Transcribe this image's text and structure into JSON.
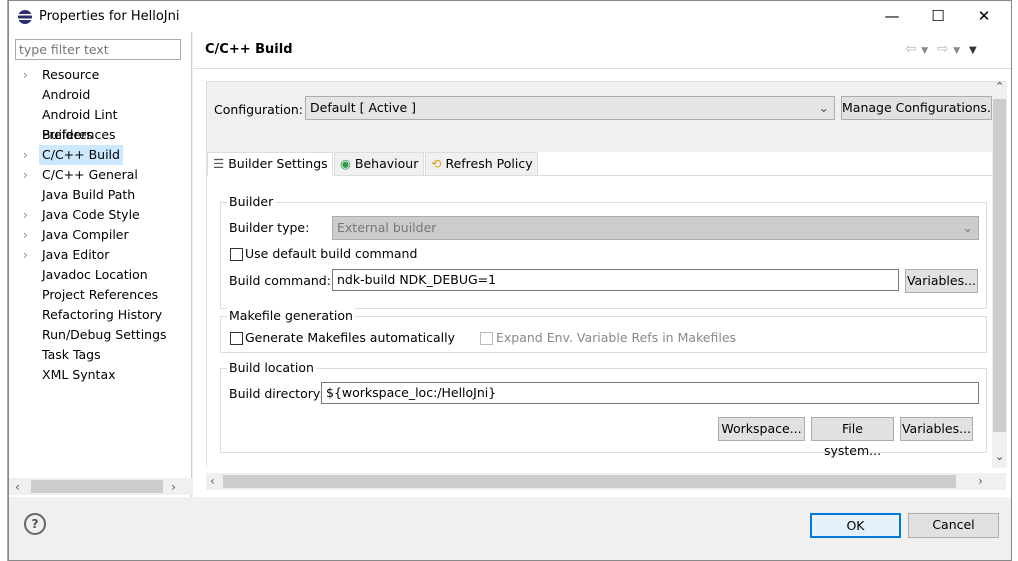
{
  "window": {
    "title": "Properties for HelloJni",
    "minimize": "—",
    "maximize": "☐",
    "close": "✕"
  },
  "sidebar": {
    "filter_placeholder": "type filter text",
    "items": [
      {
        "label": "Resource",
        "expandable": true
      },
      {
        "label": "Android",
        "expandable": false
      },
      {
        "label": "Android Lint Preferences",
        "expandable": false
      },
      {
        "label": "Builders",
        "expandable": false
      },
      {
        "label": "C/C++ Build",
        "expandable": true,
        "selected": true
      },
      {
        "label": "C/C++ General",
        "expandable": true
      },
      {
        "label": "Java Build Path",
        "expandable": false
      },
      {
        "label": "Java Code Style",
        "expandable": true
      },
      {
        "label": "Java Compiler",
        "expandable": true
      },
      {
        "label": "Java Editor",
        "expandable": true
      },
      {
        "label": "Javadoc Location",
        "expandable": false
      },
      {
        "label": "Project References",
        "expandable": false
      },
      {
        "label": "Refactoring History",
        "expandable": false
      },
      {
        "label": "Run/Debug Settings",
        "expandable": false
      },
      {
        "label": "Task Tags",
        "expandable": false
      },
      {
        "label": "XML Syntax",
        "expandable": false
      }
    ]
  },
  "page": {
    "title": "C/C++ Build",
    "configuration_label": "Configuration:",
    "configuration_value": "Default  [ Active ]",
    "manage_button": "Manage Configurations...",
    "tabs": [
      {
        "label": "Builder Settings",
        "icon": "list-icon",
        "active": true
      },
      {
        "label": "Behaviour",
        "icon": "radio-icon"
      },
      {
        "label": "Refresh Policy",
        "icon": "refresh-icon"
      }
    ],
    "builder": {
      "group": "Builder",
      "type_label": "Builder type:",
      "type_value": "External builder",
      "use_default_label": "Use default build command",
      "use_default_checked": false,
      "command_label": "Build command:",
      "command_value": "ndk-build NDK_DEBUG=1",
      "variables": "Variables..."
    },
    "makefile": {
      "group": "Makefile generation",
      "generate_label": "Generate Makefiles automatically",
      "generate_checked": false,
      "expand_label": "Expand Env. Variable Refs in Makefiles",
      "expand_checked": false
    },
    "location": {
      "group": "Build location",
      "dir_label": "Build directory:",
      "dir_value": "${workspace_loc:/HelloJni}",
      "workspace": "Workspace...",
      "filesystem": "File system...",
      "variables": "Variables..."
    }
  },
  "footer": {
    "help": "?",
    "ok": "OK",
    "cancel": "Cancel"
  }
}
